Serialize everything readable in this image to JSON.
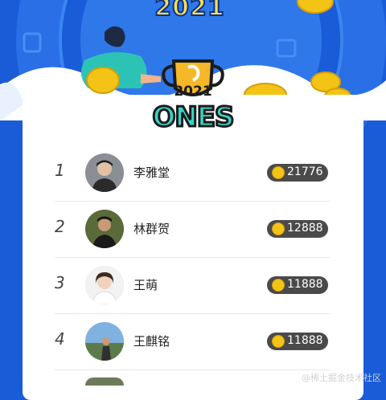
{
  "header": {
    "year": "2021"
  },
  "logo": {
    "year": "2021",
    "word": "ONES"
  },
  "leaderboard": [
    {
      "rank": "1",
      "name": "李雅堂",
      "score": "21776"
    },
    {
      "rank": "2",
      "name": "林群贺",
      "score": "12888"
    },
    {
      "rank": "3",
      "name": "王萌",
      "score": "11888"
    },
    {
      "rank": "4",
      "name": "王麒铭",
      "score": "11888"
    }
  ],
  "watermark": "@稀土掘金技术社区",
  "colors": {
    "background": "#1a5bd8",
    "coin": "#f3c316",
    "score_pill": "#4a4a4a",
    "logo_text": "#35d6c8"
  }
}
